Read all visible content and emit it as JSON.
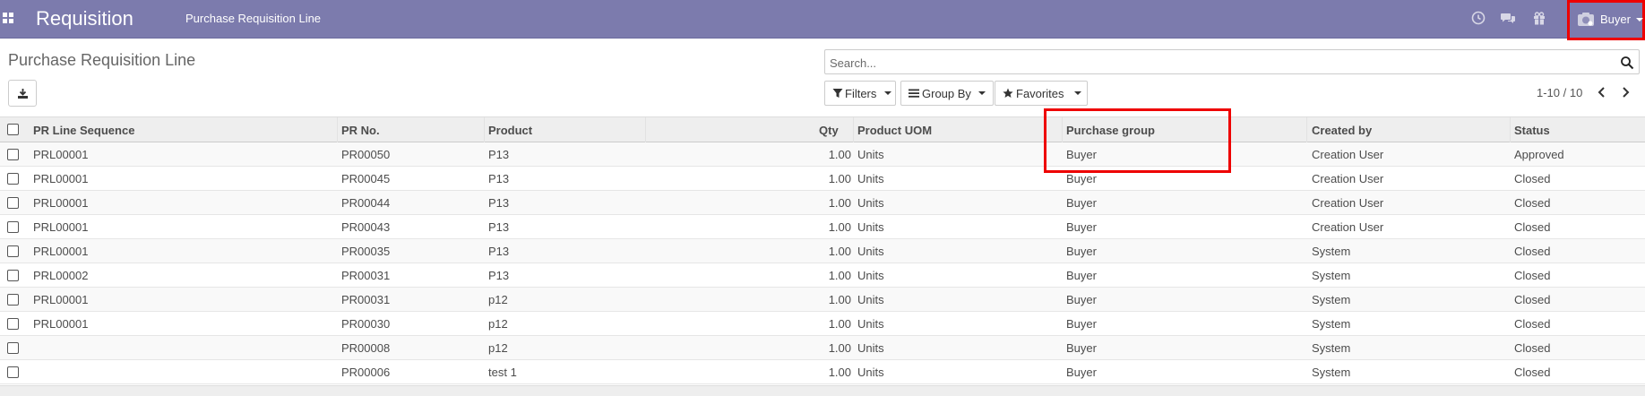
{
  "navbar": {
    "app_title": "Requisition",
    "menu_item": "Purchase Requisition Line",
    "user_name": "Buyer",
    "icons": [
      "apps-icon",
      "clock-icon",
      "chat-icon",
      "gift-icon",
      "user-avatar-icon"
    ],
    "background_color": "#7c7bad"
  },
  "control_panel": {
    "breadcrumb": "Purchase Requisition Line",
    "search_placeholder": "Search...",
    "filters_label": "Filters",
    "groupby_label": "Group By",
    "favorites_label": "Favorites",
    "pager_value": "1-10 / 10"
  },
  "table": {
    "headers": [
      "PR Line Sequence",
      "PR No.",
      "Product",
      "Qty",
      "Product UOM",
      "Purchase group",
      "Created by",
      "Status"
    ],
    "rows": [
      {
        "seq": "PRL00001",
        "pr_no": "PR00050",
        "product": "P13",
        "qty": "1.00",
        "uom": "Units",
        "group": "Buyer",
        "created_by": "Creation User",
        "status": "Approved"
      },
      {
        "seq": "PRL00001",
        "pr_no": "PR00045",
        "product": "P13",
        "qty": "1.00",
        "uom": "Units",
        "group": "Buyer",
        "created_by": "Creation User",
        "status": "Closed"
      },
      {
        "seq": "PRL00001",
        "pr_no": "PR00044",
        "product": "P13",
        "qty": "1.00",
        "uom": "Units",
        "group": "Buyer",
        "created_by": "Creation User",
        "status": "Closed"
      },
      {
        "seq": "PRL00001",
        "pr_no": "PR00043",
        "product": "P13",
        "qty": "1.00",
        "uom": "Units",
        "group": "Buyer",
        "created_by": "Creation User",
        "status": "Closed"
      },
      {
        "seq": "PRL00001",
        "pr_no": "PR00035",
        "product": "P13",
        "qty": "1.00",
        "uom": "Units",
        "group": "Buyer",
        "created_by": "System",
        "status": "Closed"
      },
      {
        "seq": "PRL00002",
        "pr_no": "PR00031",
        "product": "P13",
        "qty": "1.00",
        "uom": "Units",
        "group": "Buyer",
        "created_by": "System",
        "status": "Closed"
      },
      {
        "seq": "PRL00001",
        "pr_no": "PR00031",
        "product": "p12",
        "qty": "1.00",
        "uom": "Units",
        "group": "Buyer",
        "created_by": "System",
        "status": "Closed"
      },
      {
        "seq": "PRL00001",
        "pr_no": "PR00030",
        "product": "p12",
        "qty": "1.00",
        "uom": "Units",
        "group": "Buyer",
        "created_by": "System",
        "status": "Closed"
      },
      {
        "seq": "",
        "pr_no": "PR00008",
        "product": "p12",
        "qty": "1.00",
        "uom": "Units",
        "group": "Buyer",
        "created_by": "System",
        "status": "Closed"
      },
      {
        "seq": "",
        "pr_no": "PR00006",
        "product": "test 1",
        "qty": "1.00",
        "uom": "Units",
        "group": "Buyer",
        "created_by": "System",
        "status": "Closed"
      }
    ]
  },
  "annotations": {
    "highlight_color": "#ee0000"
  }
}
